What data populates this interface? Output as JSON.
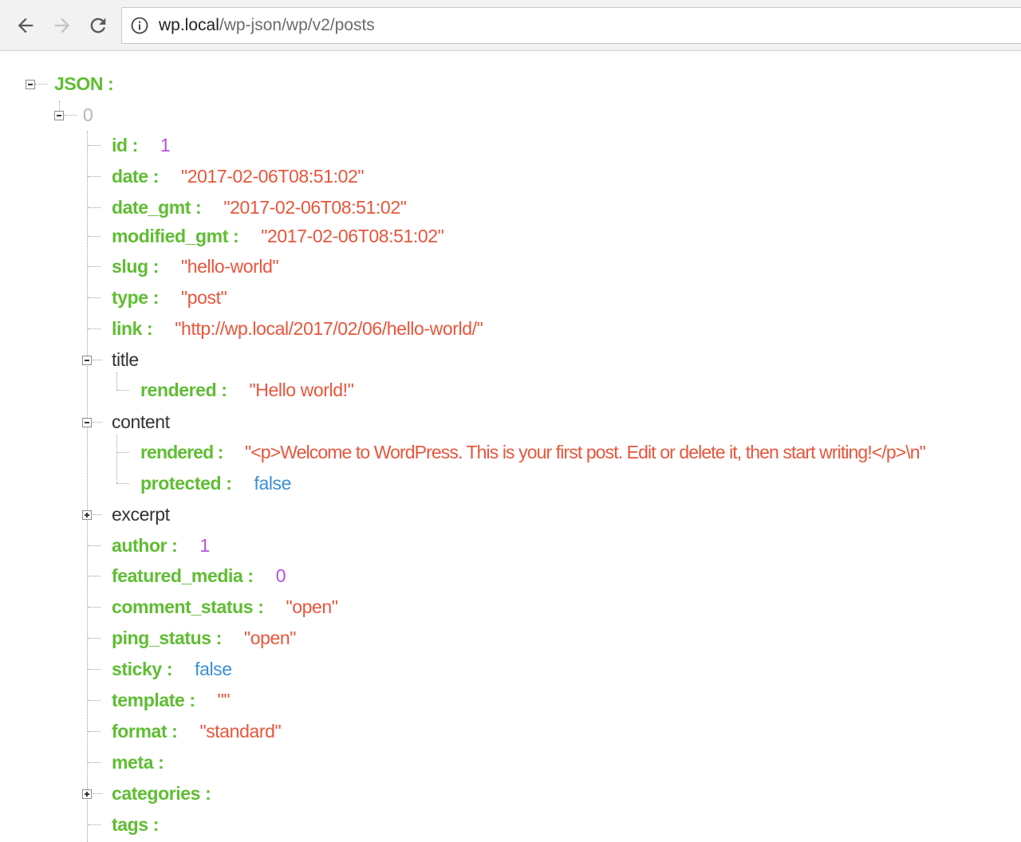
{
  "browser": {
    "url_host": "wp.local",
    "url_path": "/wp-json/wp/v2/posts",
    "icons": {
      "back": "arrow-left-icon",
      "forward": "arrow-right-icon",
      "reload": "reload-icon",
      "info": "info-icon"
    }
  },
  "viewer": {
    "root_label": "JSON",
    "item_index": "0",
    "colon": ":",
    "fields": {
      "id": {
        "key": "id",
        "value": "1"
      },
      "date": {
        "key": "date",
        "value": "\"2017-02-06T08:51:02\""
      },
      "date_gmt": {
        "key": "date_gmt",
        "value": "\"2017-02-06T08:51:02\""
      },
      "modified_gmt": {
        "key": "modified_gmt",
        "value": "\"2017-02-06T08:51:02\""
      },
      "slug": {
        "key": "slug",
        "value": "\"hello-world\""
      },
      "type": {
        "key": "type",
        "value": "\"post\""
      },
      "link": {
        "key": "link",
        "value": "\"http://wp.local/2017/02/06/hello-world/\""
      },
      "title": {
        "key": "title",
        "rendered_key": "rendered",
        "rendered_value": "\"Hello world!\""
      },
      "content": {
        "key": "content",
        "rendered_key": "rendered",
        "rendered_value": "\"<p>Welcome to WordPress. This is your first post. Edit or delete it, then start writing!</p>\\n\"",
        "protected_key": "protected",
        "protected_value": "false"
      },
      "excerpt": {
        "key": "excerpt"
      },
      "author": {
        "key": "author",
        "value": "1"
      },
      "featured_media": {
        "key": "featured_media",
        "value": "0"
      },
      "comment_status": {
        "key": "comment_status",
        "value": "\"open\""
      },
      "ping_status": {
        "key": "ping_status",
        "value": "\"open\""
      },
      "sticky": {
        "key": "sticky",
        "value": "false"
      },
      "template": {
        "key": "template",
        "value": "\"\""
      },
      "format": {
        "key": "format",
        "value": "\"standard\""
      },
      "meta": {
        "key": "meta"
      },
      "categories": {
        "key": "categories"
      },
      "tags": {
        "key": "tags"
      }
    },
    "colors": {
      "key": "#5fbd32",
      "string": "#e8563c",
      "number": "#b94fe0",
      "boolean": "#3a8fd6"
    }
  }
}
